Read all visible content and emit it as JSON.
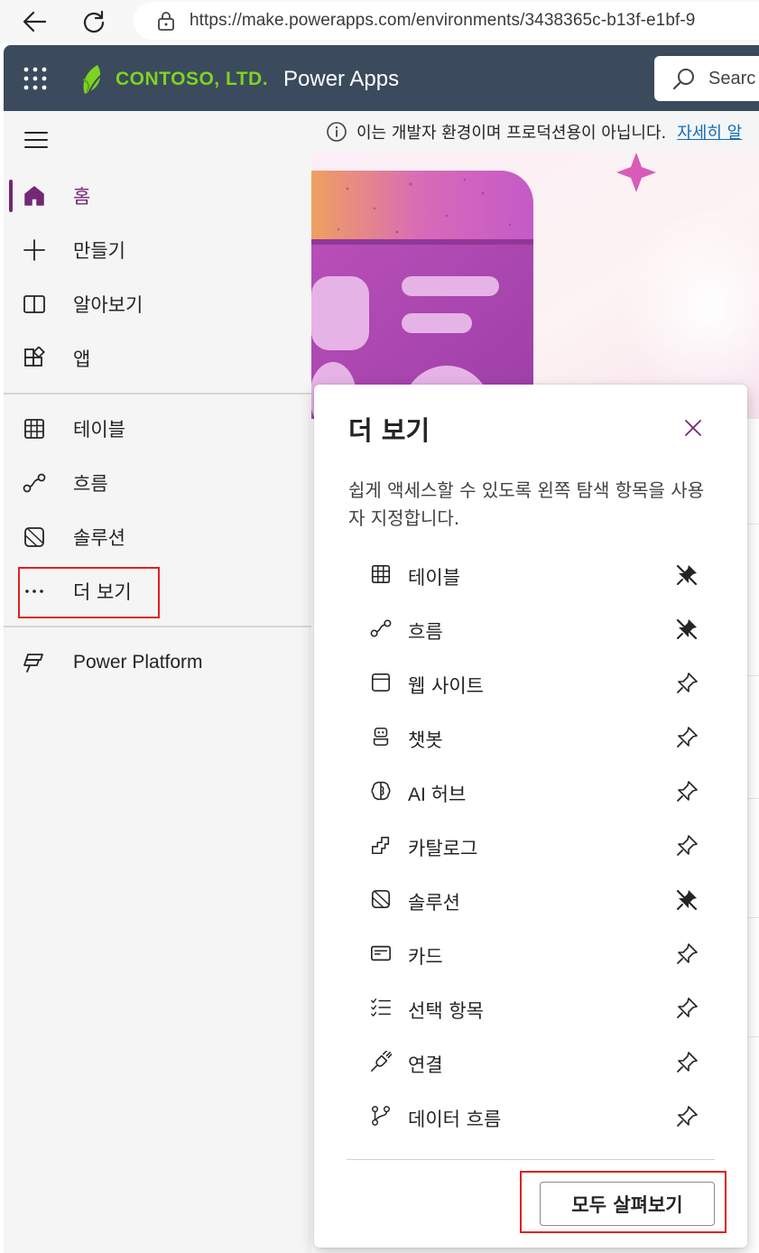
{
  "browser": {
    "url": "https://make.powerapps.com/environments/3438365c-b13f-e1bf-9"
  },
  "header": {
    "logo_text": "CONTOSO, LTD.",
    "app_title": "Power Apps",
    "search_placeholder": "Searc"
  },
  "sidebar": {
    "items": [
      {
        "label": "홈",
        "icon": "home-icon",
        "active": true
      },
      {
        "label": "만들기",
        "icon": "plus-icon"
      },
      {
        "label": "알아보기",
        "icon": "book-icon"
      },
      {
        "label": "앱",
        "icon": "apps-icon"
      },
      {
        "label": "테이블",
        "icon": "table-icon"
      },
      {
        "label": "흐름",
        "icon": "flow-icon"
      },
      {
        "label": "솔루션",
        "icon": "solution-icon"
      },
      {
        "label": "더 보기",
        "icon": "more-icon"
      },
      {
        "label": "Power Platform",
        "icon": "power-platform-icon"
      }
    ]
  },
  "info_bar": {
    "text": "이는 개발자 환경이며 프로덕션용이 아닙니다.",
    "link": "자세히 알"
  },
  "panel": {
    "title": "더 보기",
    "description": "쉽게 액세스할 수 있도록 왼쪽 탐색 항목을 사용자 지정합니다.",
    "items": [
      {
        "label": "테이블",
        "icon": "table-icon",
        "pinned": true
      },
      {
        "label": "흐름",
        "icon": "flow-icon",
        "pinned": true
      },
      {
        "label": "웹 사이트",
        "icon": "website-icon",
        "pinned": false
      },
      {
        "label": "챗봇",
        "icon": "bot-icon",
        "pinned": false
      },
      {
        "label": "AI 허브",
        "icon": "brain-icon",
        "pinned": false
      },
      {
        "label": "카탈로그",
        "icon": "catalog-icon",
        "pinned": false
      },
      {
        "label": "솔루션",
        "icon": "solution-icon",
        "pinned": true
      },
      {
        "label": "카드",
        "icon": "card-icon",
        "pinned": false
      },
      {
        "label": "선택 항목",
        "icon": "choices-icon",
        "pinned": false
      },
      {
        "label": "연결",
        "icon": "connection-icon",
        "pinned": false
      },
      {
        "label": "데이터 흐름",
        "icon": "dataflow-icon",
        "pinned": false
      }
    ],
    "browse_all_label": "모두 살펴보기"
  },
  "colors": {
    "header_bg": "#3b4a5c",
    "accent": "#742774",
    "highlight_box": "#e02020",
    "link": "#0f6cbd"
  }
}
